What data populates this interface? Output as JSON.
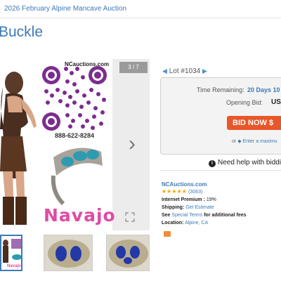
{
  "breadcrumb": {
    "text": "2026 February Alpine Mancave Auction"
  },
  "item": {
    "title": "Buckle"
  },
  "viewer": {
    "counter": "3 / 7",
    "brand_url": "NCauctions.com",
    "phone": "888-622-8284",
    "navajo_text": "Navajo",
    "thumb_label": "Navajo"
  },
  "lot": {
    "label": "Lot #1034"
  },
  "bidding": {
    "time_label": "Time Remaining:",
    "time_value": "20 Days 10",
    "opening_label": "Opening Bid:",
    "opening_value": "US",
    "bid_button": "BID NOW $",
    "or_text": "or",
    "max_link": "Enter a maximu"
  },
  "help": {
    "text": "Need help with biddin"
  },
  "seller": {
    "name": "NCAuctions.com",
    "stars": "★★★★★",
    "rating_count": "(3063)",
    "premium_label": "Internet Premium :",
    "premium_value": "19%",
    "shipping_label": "Shipping:",
    "shipping_value": "Get Estimate",
    "terms_prefix": "See",
    "terms_link": "Special Terms",
    "terms_suffix": "for additional fees",
    "location_label": "Location:",
    "location_value": "Alpine, CA"
  },
  "colors": {
    "link": "#3d7ab8",
    "bid_button": "#e8572a",
    "accent_pink": "#e04aa5",
    "qr_purple": "#7b2d8e"
  }
}
